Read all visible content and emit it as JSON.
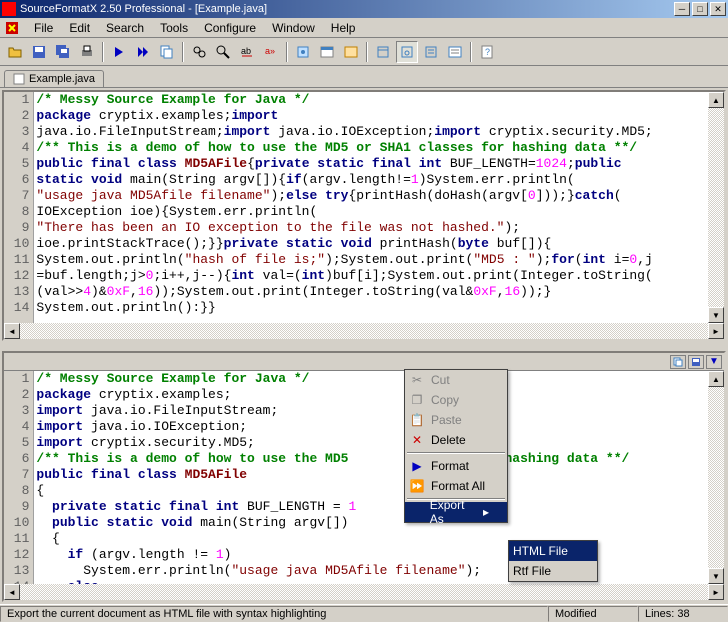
{
  "window": {
    "title": "SourceFormatX 2.50 Professional - [Example.java]"
  },
  "menu": {
    "items": [
      "File",
      "Edit",
      "Search",
      "Tools",
      "Configure",
      "Window",
      "Help"
    ]
  },
  "tab": {
    "label": "Example.java"
  },
  "statusbar": {
    "hint": "Export the current document as HTML file with syntax highlighting",
    "modified": "Modified",
    "lines": "Lines: 38"
  },
  "context_menu": {
    "cut": "Cut",
    "copy": "Copy",
    "paste": "Paste",
    "delete": "Delete",
    "format": "Format",
    "format_all": "Format All",
    "export_as": "Export As"
  },
  "submenu": {
    "html_file": "HTML File",
    "rtf_file": "Rtf File"
  },
  "code_top": {
    "l1": "<span class='cm'>/* Messy Source Example for Java */</span>",
    "l2": "<span class='kw'>package</span> cryptix.examples;<span class='kw'>import</span>",
    "l3": "java.io.FileInputStream;<span class='kw'>import</span> java.io.IOException;<span class='kw'>import</span> cryptix.security.MD5;",
    "l4": "<span class='cm'>/** This is a demo of how to use the MD5 or SHA1 classes for hashing data **/</span>",
    "l5": "<span class='kw'>public final class</span> <span class='cls'>MD5AFile</span>{<span class='kw'>private static final int</span> BUF_LENGTH=<span class='num'>1024</span>;<span class='kw'>public</span>",
    "l6": "<span class='kw'>static void</span> main(String argv[]){<span class='kw'>if</span>(argv.length!=<span class='num'>1</span>)System.err.println(",
    "l7": "<span class='str'>\"usage java MD5Afile filename\"</span>);<span class='kw'>else try</span>{printHash(doHash(argv[<span class='num'>0</span>]));}<span class='kw'>catch</span>(",
    "l8": "IOException ioe){System.err.println(",
    "l9": "<span class='str'>\"There has been an IO exception to the file was not hashed.\"</span>);",
    "l10": "ioe.printStackTrace();}}<span class='kw'>private static void</span> printHash(<span class='kw'>byte</span> buf[]){",
    "l11": "System.out.println(<span class='str'>\"hash of file is;\"</span>);System.out.print(<span class='str'>\"MD5 : \"</span>);<span class='kw'>for</span>(<span class='kw'>int</span> i=<span class='num'>0</span>,j",
    "l12": "=buf.length;j&gt;<span class='num'>0</span>;i++,j--){<span class='kw'>int</span> val=(<span class='kw'>int</span>)buf[i];System.out.print(Integer.toString(",
    "l13": "(val&gt;&gt;<span class='num'>4</span>)&amp;<span class='num'>0xF</span>,<span class='num'>16</span>));System.out.print(Integer.toString(val&amp;<span class='num'>0xF</span>,<span class='num'>16</span>));}",
    "l14": "System.out.println():}}"
  },
  "code_bottom": {
    "l1": "<span class='cm'>/* Messy Source Example for Java */</span>",
    "l2": "<span class='kw'>package</span> cryptix.examples;",
    "l3": "<span class='kw'>import</span> java.io.FileInputStream;",
    "l4": "<span class='kw'>import</span> java.io.IOException;",
    "l5": "<span class='kw'>import</span> cryptix.security.MD5;",
    "l6": "<span class='cm'>/** This is a demo of how to use the MD5 </span>              <span class='cm'> for hashing data **/</span>",
    "l7": "<span class='kw'>public final class</span> <span class='cls'>MD5AFile</span>",
    "l8": "{",
    "l9": "  <span class='kw'>private static final int</span> BUF_LENGTH = <span class='num'>1</span>",
    "l10": "  <span class='kw'>public static void</span> main(String argv[])",
    "l11": "  {",
    "l12": "    <span class='kw'>if</span> (argv.length != <span class='num'>1</span>)",
    "l13": "      System.err.println(<span class='str'>\"usage java MD5Afile filename\"</span>);",
    "l14": "    <span class='kw'>else</span>"
  }
}
